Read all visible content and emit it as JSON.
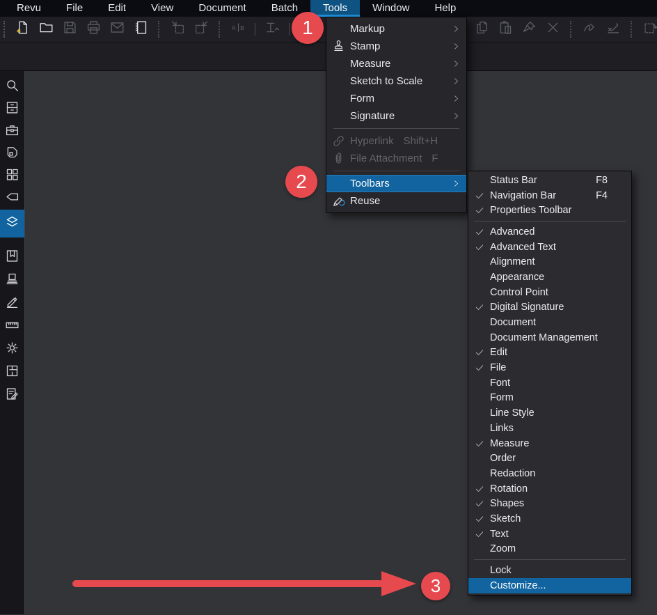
{
  "colors": {
    "accent_blue": "#1164a0",
    "active_tab_blue": "#0e5381",
    "tab_underline_blue": "#1f8ed6",
    "annotation_red": "#e64a4e",
    "canvas_gray": "#333438",
    "menu_background": "#26262b",
    "submenu_background": "#2c2c30",
    "sparkle_yellow": "#d4af37"
  },
  "menubar": {
    "items": [
      {
        "label": "Revu"
      },
      {
        "label": "File"
      },
      {
        "label": "Edit"
      },
      {
        "label": "View"
      },
      {
        "label": "Document"
      },
      {
        "label": "Batch"
      },
      {
        "label": "Tools",
        "active": true
      },
      {
        "label": "Window"
      },
      {
        "label": "Help"
      }
    ]
  },
  "toolbar": {
    "items": [
      {
        "type": "handle",
        "name": "toolbar-drag-handle"
      },
      {
        "type": "icon",
        "name": "new-document"
      },
      {
        "type": "icon",
        "name": "open-folder"
      },
      {
        "type": "icon",
        "name": "save",
        "state": "disabled"
      },
      {
        "type": "icon",
        "name": "print",
        "state": "disabled"
      },
      {
        "type": "icon",
        "name": "email",
        "state": "disabled"
      },
      {
        "type": "icon",
        "name": "profile-notebook"
      },
      {
        "type": "sep"
      },
      {
        "type": "icon",
        "name": "insert-pages",
        "state": "disabled"
      },
      {
        "type": "icon",
        "name": "extract-pages",
        "state": "disabled"
      },
      {
        "type": "sep"
      },
      {
        "type": "icon",
        "name": "compare-ab",
        "state": "disabled"
      },
      {
        "type": "divider"
      },
      {
        "type": "icon",
        "name": "ocr-text",
        "state": "disabled"
      },
      {
        "type": "divider"
      },
      {
        "type": "icon",
        "name": "text-markup",
        "state": "disabled"
      },
      {
        "type": "gap"
      },
      {
        "type": "icon",
        "name": "copy",
        "state": "disabled"
      },
      {
        "type": "icon",
        "name": "paste",
        "state": "disabled"
      },
      {
        "type": "icon",
        "name": "format-paint",
        "state": "disabled"
      },
      {
        "type": "icon",
        "name": "delete-x",
        "state": "disabled"
      },
      {
        "type": "sep"
      },
      {
        "type": "icon",
        "name": "apply-signature",
        "state": "disabled"
      },
      {
        "type": "icon",
        "name": "sign-document",
        "state": "disabled"
      },
      {
        "type": "sep"
      },
      {
        "type": "icon",
        "name": "revert-snapshot",
        "state": "disabled"
      },
      {
        "type": "sep"
      }
    ]
  },
  "sidebar": {
    "items": [
      {
        "name": "search"
      },
      {
        "name": "file-access"
      },
      {
        "name": "tool-chest"
      },
      {
        "name": "studio"
      },
      {
        "name": "thumbnails"
      },
      {
        "name": "tag"
      },
      {
        "name": "layers",
        "active": true
      },
      {
        "name": "bookmarks"
      },
      {
        "name": "sets"
      },
      {
        "name": "signatures"
      },
      {
        "name": "measurements"
      },
      {
        "name": "properties"
      },
      {
        "name": "spaces"
      },
      {
        "name": "markups-list"
      }
    ]
  },
  "tools_menu": {
    "items": [
      {
        "label": "Markup",
        "submenu": true
      },
      {
        "label": "Stamp",
        "icon": "stamp",
        "submenu": true
      },
      {
        "label": "Measure",
        "submenu": true
      },
      {
        "label": "Sketch to Scale",
        "submenu": true
      },
      {
        "label": "Form",
        "submenu": true
      },
      {
        "label": "Signature",
        "submenu": true
      },
      {
        "type": "sep"
      },
      {
        "label": "Hyperlink",
        "icon": "hyperlink",
        "shortcut": "Shift+H",
        "disabled": true
      },
      {
        "label": "File Attachment",
        "icon": "paperclip",
        "shortcut": "F",
        "disabled": true
      },
      {
        "type": "sep"
      },
      {
        "label": "Toolbars",
        "submenu": true,
        "highlighted": true
      },
      {
        "label": "Reuse",
        "icon": "reuse"
      }
    ]
  },
  "toolbars_submenu": {
    "items": [
      {
        "label": "Status Bar",
        "shortcut": "F8"
      },
      {
        "label": "Navigation Bar",
        "shortcut": "F4",
        "checked": true
      },
      {
        "label": "Properties Toolbar",
        "checked": true
      },
      {
        "type": "sep"
      },
      {
        "label": "Advanced",
        "checked": true
      },
      {
        "label": "Advanced Text",
        "checked": true
      },
      {
        "label": "Alignment"
      },
      {
        "label": "Appearance"
      },
      {
        "label": "Control Point"
      },
      {
        "label": "Digital Signature",
        "checked": true
      },
      {
        "label": "Document"
      },
      {
        "label": "Document Management"
      },
      {
        "label": "Edit",
        "checked": true
      },
      {
        "label": "File",
        "checked": true
      },
      {
        "label": "Font"
      },
      {
        "label": "Form"
      },
      {
        "label": "Line Style"
      },
      {
        "label": "Links"
      },
      {
        "label": "Measure",
        "checked": true
      },
      {
        "label": "Order"
      },
      {
        "label": "Redaction"
      },
      {
        "label": "Rotation",
        "checked": true
      },
      {
        "label": "Shapes",
        "checked": true
      },
      {
        "label": "Sketch",
        "checked": true
      },
      {
        "label": "Text",
        "checked": true
      },
      {
        "label": "Zoom"
      },
      {
        "type": "sep"
      },
      {
        "label": "Lock"
      },
      {
        "label": "Customize...",
        "highlighted": true
      }
    ]
  },
  "annotations": {
    "step_1": "1",
    "step_2": "2",
    "step_3": "3"
  }
}
